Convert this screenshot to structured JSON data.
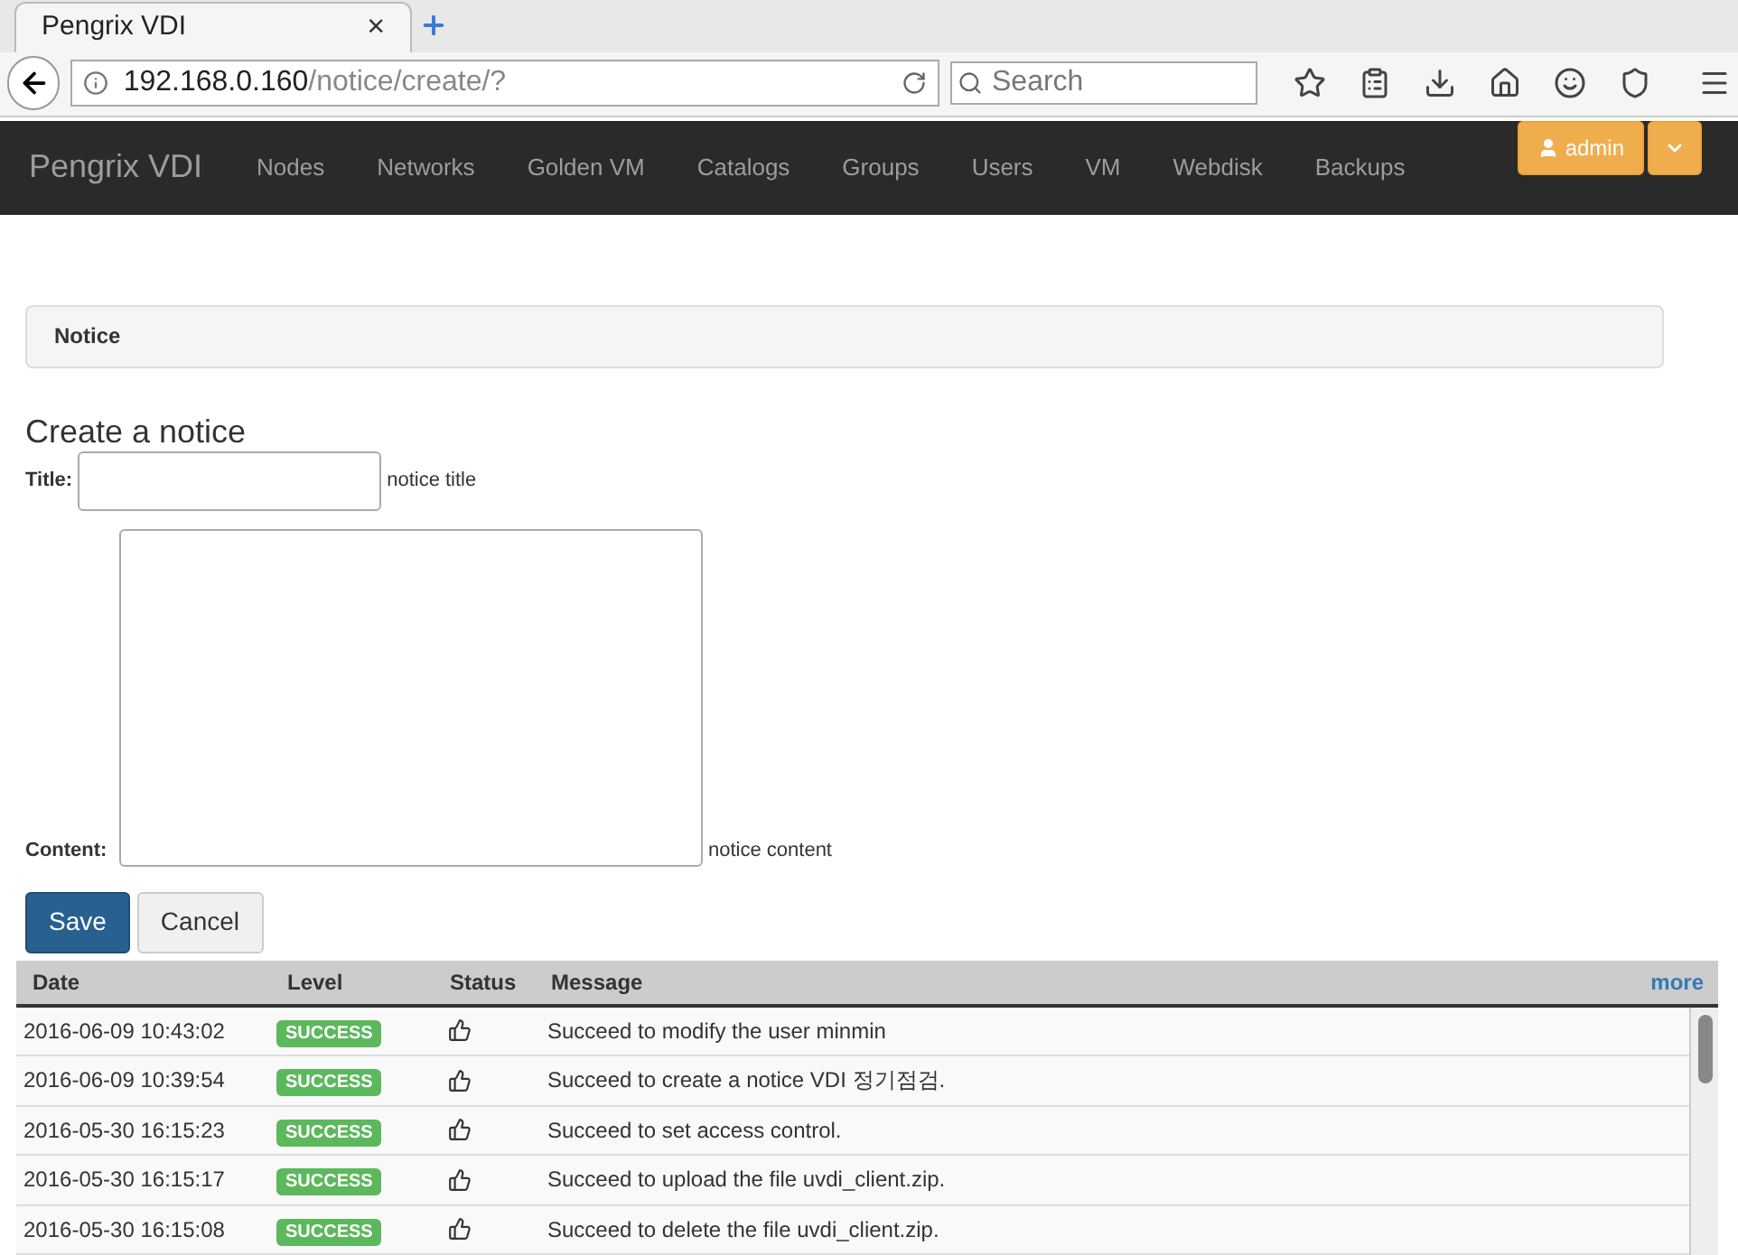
{
  "browser": {
    "tab_title": "Pengrix VDI",
    "close_glyph": "×",
    "address": {
      "host": "192.168.0.160",
      "path": "/notice/create/?"
    },
    "search": {
      "placeholder": "Search"
    }
  },
  "navbar": {
    "brand": "Pengrix VDI",
    "items": [
      "Nodes",
      "Networks",
      "Golden VM",
      "Catalogs",
      "Groups",
      "Users",
      "VM",
      "Webdisk",
      "Backups"
    ],
    "user": "admin"
  },
  "breadcrumb": "Notice",
  "form": {
    "heading": "Create a notice",
    "title_label": "Title:",
    "title_hint": "notice title",
    "content_label": "Content:",
    "content_hint": "notice content",
    "buttons": [
      "Save",
      "Cancel"
    ]
  },
  "log": {
    "columns": [
      "Date",
      "Level",
      "Status",
      "Message"
    ],
    "more": "more",
    "rows": [
      {
        "date": "2016-06-09 10:43:02",
        "level": "SUCCESS",
        "message": "Succeed to modify the user minmin"
      },
      {
        "date": "2016-06-09 10:39:54",
        "level": "SUCCESS",
        "message": "Succeed to create a notice VDI 정기점검."
      },
      {
        "date": "2016-05-30 16:15:23",
        "level": "SUCCESS",
        "message": "Succeed to set access control."
      },
      {
        "date": "2016-05-30 16:15:17",
        "level": "SUCCESS",
        "message": "Succeed to upload the file uvdi_client.zip."
      },
      {
        "date": "2016-05-30 16:15:08",
        "level": "SUCCESS",
        "message": "Succeed to delete the file uvdi_client.zip."
      }
    ]
  }
}
